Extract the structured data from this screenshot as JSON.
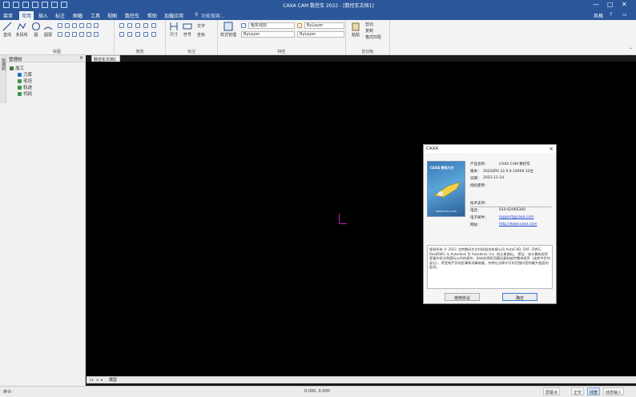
{
  "window": {
    "title": "CAXA CAM 数控车 2022 - [数控车文档1]",
    "controls": [
      "—",
      "□",
      "✕"
    ]
  },
  "menu": {
    "items": [
      "菜单",
      "常用",
      "插入",
      "标注",
      "图幅",
      "工具",
      "视图",
      "数控车",
      "帮助",
      "加载应用"
    ],
    "search_placeholder": "功能搜索...",
    "right_label": "风格"
  },
  "ribbon": {
    "draw": {
      "label": "绘图",
      "tools": [
        "直线",
        "多段线",
        "圆",
        "圆弧"
      ]
    },
    "modify": {
      "label": "修改"
    },
    "dimension": {
      "label": "标注",
      "tools": [
        "尺寸",
        "符号"
      ],
      "small": [
        "文字",
        "坐标"
      ]
    },
    "properties": {
      "label": "特性",
      "style_manage": "样式管理",
      "layer_combo": "粗实线层",
      "color_combo": "ByLayer",
      "linetype_combo": "ByLayer",
      "lineweight_combo": "ByLayer"
    },
    "clipboard": {
      "label": "剪切板",
      "paste": "粘贴",
      "items": [
        "剪切",
        "复制",
        "格式匹配"
      ]
    }
  },
  "panel": {
    "side_tab": "管理树",
    "title": "管理树",
    "root": "加工",
    "items": [
      "刀库",
      "毛坯",
      "轨迹",
      "代码"
    ]
  },
  "document": {
    "tab": "数控车文档1"
  },
  "model_tab": "模型",
  "status": {
    "command": "命令:",
    "coord": "0.000, 0.000",
    "buttons": [
      "屏幕点",
      "正交",
      "线宽",
      "动态输入"
    ]
  },
  "colors": {
    "title_bar": "#2b579a",
    "canvas": "#000000",
    "cursor": "#c020c0",
    "link": "#1a3ed6"
  },
  "about_dialog": {
    "title": "CAXA",
    "image_brand": "CAXA 数码大方",
    "image_url": "www.caxa.com",
    "product_label": "产品名称：",
    "product_value": "CAXA CAM 数控车",
    "version_label": "版本：",
    "version_value": "2022SP0 22.0.0.14609 32位",
    "date_label": "日期：",
    "date_value": "2021-11-14",
    "license_label": "授权使用：",
    "support_label": "技术支持：",
    "phone_label": "电话：",
    "phone_value": "010-62466300",
    "email_label": "电子邮件：",
    "email_value": "support@caxa.com",
    "website_label": "网站：",
    "website_value": "http://www.caxa.com",
    "copyright_text": "版权所有 © 2021 北京数码大方科技股份有限公司\nAutoCAD, DXF, DWG, RealDWG 与 Autodesk 为 Autodesk, Inc. 的注册商标。\n警告：本计算机程序受著作权法和国际公约的保护。如未经授权而擅自复制或传播本程序（或其中任何部分），将受到严厉的民事和刑事制裁，并将在法律许可的范围内受到最大程度的起诉。",
    "agreement_button": "使用协议",
    "ok_button": "确定"
  }
}
